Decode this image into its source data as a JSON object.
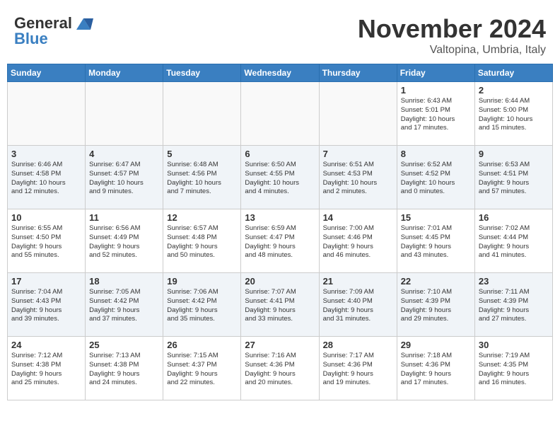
{
  "header": {
    "logo_line1": "General",
    "logo_line2": "Blue",
    "month_title": "November 2024",
    "location": "Valtopina, Umbria, Italy"
  },
  "days_of_week": [
    "Sunday",
    "Monday",
    "Tuesday",
    "Wednesday",
    "Thursday",
    "Friday",
    "Saturday"
  ],
  "weeks": [
    [
      {
        "day": "",
        "info": ""
      },
      {
        "day": "",
        "info": ""
      },
      {
        "day": "",
        "info": ""
      },
      {
        "day": "",
        "info": ""
      },
      {
        "day": "",
        "info": ""
      },
      {
        "day": "1",
        "info": "Sunrise: 6:43 AM\nSunset: 5:01 PM\nDaylight: 10 hours\nand 17 minutes."
      },
      {
        "day": "2",
        "info": "Sunrise: 6:44 AM\nSunset: 5:00 PM\nDaylight: 10 hours\nand 15 minutes."
      }
    ],
    [
      {
        "day": "3",
        "info": "Sunrise: 6:46 AM\nSunset: 4:58 PM\nDaylight: 10 hours\nand 12 minutes."
      },
      {
        "day": "4",
        "info": "Sunrise: 6:47 AM\nSunset: 4:57 PM\nDaylight: 10 hours\nand 9 minutes."
      },
      {
        "day": "5",
        "info": "Sunrise: 6:48 AM\nSunset: 4:56 PM\nDaylight: 10 hours\nand 7 minutes."
      },
      {
        "day": "6",
        "info": "Sunrise: 6:50 AM\nSunset: 4:55 PM\nDaylight: 10 hours\nand 4 minutes."
      },
      {
        "day": "7",
        "info": "Sunrise: 6:51 AM\nSunset: 4:53 PM\nDaylight: 10 hours\nand 2 minutes."
      },
      {
        "day": "8",
        "info": "Sunrise: 6:52 AM\nSunset: 4:52 PM\nDaylight: 10 hours\nand 0 minutes."
      },
      {
        "day": "9",
        "info": "Sunrise: 6:53 AM\nSunset: 4:51 PM\nDaylight: 9 hours\nand 57 minutes."
      }
    ],
    [
      {
        "day": "10",
        "info": "Sunrise: 6:55 AM\nSunset: 4:50 PM\nDaylight: 9 hours\nand 55 minutes."
      },
      {
        "day": "11",
        "info": "Sunrise: 6:56 AM\nSunset: 4:49 PM\nDaylight: 9 hours\nand 52 minutes."
      },
      {
        "day": "12",
        "info": "Sunrise: 6:57 AM\nSunset: 4:48 PM\nDaylight: 9 hours\nand 50 minutes."
      },
      {
        "day": "13",
        "info": "Sunrise: 6:59 AM\nSunset: 4:47 PM\nDaylight: 9 hours\nand 48 minutes."
      },
      {
        "day": "14",
        "info": "Sunrise: 7:00 AM\nSunset: 4:46 PM\nDaylight: 9 hours\nand 46 minutes."
      },
      {
        "day": "15",
        "info": "Sunrise: 7:01 AM\nSunset: 4:45 PM\nDaylight: 9 hours\nand 43 minutes."
      },
      {
        "day": "16",
        "info": "Sunrise: 7:02 AM\nSunset: 4:44 PM\nDaylight: 9 hours\nand 41 minutes."
      }
    ],
    [
      {
        "day": "17",
        "info": "Sunrise: 7:04 AM\nSunset: 4:43 PM\nDaylight: 9 hours\nand 39 minutes."
      },
      {
        "day": "18",
        "info": "Sunrise: 7:05 AM\nSunset: 4:42 PM\nDaylight: 9 hours\nand 37 minutes."
      },
      {
        "day": "19",
        "info": "Sunrise: 7:06 AM\nSunset: 4:42 PM\nDaylight: 9 hours\nand 35 minutes."
      },
      {
        "day": "20",
        "info": "Sunrise: 7:07 AM\nSunset: 4:41 PM\nDaylight: 9 hours\nand 33 minutes."
      },
      {
        "day": "21",
        "info": "Sunrise: 7:09 AM\nSunset: 4:40 PM\nDaylight: 9 hours\nand 31 minutes."
      },
      {
        "day": "22",
        "info": "Sunrise: 7:10 AM\nSunset: 4:39 PM\nDaylight: 9 hours\nand 29 minutes."
      },
      {
        "day": "23",
        "info": "Sunrise: 7:11 AM\nSunset: 4:39 PM\nDaylight: 9 hours\nand 27 minutes."
      }
    ],
    [
      {
        "day": "24",
        "info": "Sunrise: 7:12 AM\nSunset: 4:38 PM\nDaylight: 9 hours\nand 25 minutes."
      },
      {
        "day": "25",
        "info": "Sunrise: 7:13 AM\nSunset: 4:38 PM\nDaylight: 9 hours\nand 24 minutes."
      },
      {
        "day": "26",
        "info": "Sunrise: 7:15 AM\nSunset: 4:37 PM\nDaylight: 9 hours\nand 22 minutes."
      },
      {
        "day": "27",
        "info": "Sunrise: 7:16 AM\nSunset: 4:36 PM\nDaylight: 9 hours\nand 20 minutes."
      },
      {
        "day": "28",
        "info": "Sunrise: 7:17 AM\nSunset: 4:36 PM\nDaylight: 9 hours\nand 19 minutes."
      },
      {
        "day": "29",
        "info": "Sunrise: 7:18 AM\nSunset: 4:36 PM\nDaylight: 9 hours\nand 17 minutes."
      },
      {
        "day": "30",
        "info": "Sunrise: 7:19 AM\nSunset: 4:35 PM\nDaylight: 9 hours\nand 16 minutes."
      }
    ]
  ]
}
